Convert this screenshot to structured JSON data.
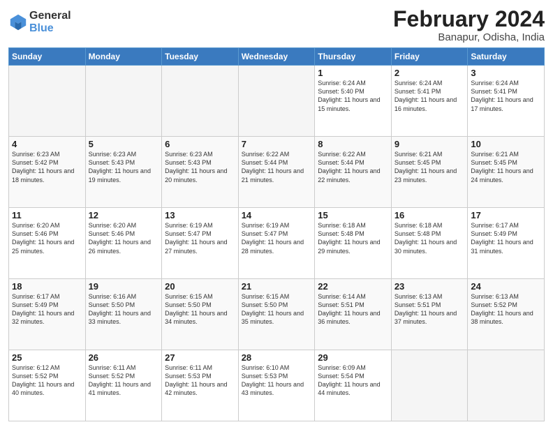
{
  "header": {
    "logo_line1": "General",
    "logo_line2": "Blue",
    "month_title": "February 2024",
    "location": "Banapur, Odisha, India"
  },
  "days_of_week": [
    "Sunday",
    "Monday",
    "Tuesday",
    "Wednesday",
    "Thursday",
    "Friday",
    "Saturday"
  ],
  "weeks": [
    [
      {
        "day": "",
        "info": "",
        "empty": true
      },
      {
        "day": "",
        "info": "",
        "empty": true
      },
      {
        "day": "",
        "info": "",
        "empty": true
      },
      {
        "day": "",
        "info": "",
        "empty": true
      },
      {
        "day": "1",
        "info": "Sunrise: 6:24 AM\nSunset: 5:40 PM\nDaylight: 11 hours\nand 15 minutes.",
        "empty": false
      },
      {
        "day": "2",
        "info": "Sunrise: 6:24 AM\nSunset: 5:41 PM\nDaylight: 11 hours\nand 16 minutes.",
        "empty": false
      },
      {
        "day": "3",
        "info": "Sunrise: 6:24 AM\nSunset: 5:41 PM\nDaylight: 11 hours\nand 17 minutes.",
        "empty": false
      }
    ],
    [
      {
        "day": "4",
        "info": "Sunrise: 6:23 AM\nSunset: 5:42 PM\nDaylight: 11 hours\nand 18 minutes.",
        "empty": false
      },
      {
        "day": "5",
        "info": "Sunrise: 6:23 AM\nSunset: 5:43 PM\nDaylight: 11 hours\nand 19 minutes.",
        "empty": false
      },
      {
        "day": "6",
        "info": "Sunrise: 6:23 AM\nSunset: 5:43 PM\nDaylight: 11 hours\nand 20 minutes.",
        "empty": false
      },
      {
        "day": "7",
        "info": "Sunrise: 6:22 AM\nSunset: 5:44 PM\nDaylight: 11 hours\nand 21 minutes.",
        "empty": false
      },
      {
        "day": "8",
        "info": "Sunrise: 6:22 AM\nSunset: 5:44 PM\nDaylight: 11 hours\nand 22 minutes.",
        "empty": false
      },
      {
        "day": "9",
        "info": "Sunrise: 6:21 AM\nSunset: 5:45 PM\nDaylight: 11 hours\nand 23 minutes.",
        "empty": false
      },
      {
        "day": "10",
        "info": "Sunrise: 6:21 AM\nSunset: 5:45 PM\nDaylight: 11 hours\nand 24 minutes.",
        "empty": false
      }
    ],
    [
      {
        "day": "11",
        "info": "Sunrise: 6:20 AM\nSunset: 5:46 PM\nDaylight: 11 hours\nand 25 minutes.",
        "empty": false
      },
      {
        "day": "12",
        "info": "Sunrise: 6:20 AM\nSunset: 5:46 PM\nDaylight: 11 hours\nand 26 minutes.",
        "empty": false
      },
      {
        "day": "13",
        "info": "Sunrise: 6:19 AM\nSunset: 5:47 PM\nDaylight: 11 hours\nand 27 minutes.",
        "empty": false
      },
      {
        "day": "14",
        "info": "Sunrise: 6:19 AM\nSunset: 5:47 PM\nDaylight: 11 hours\nand 28 minutes.",
        "empty": false
      },
      {
        "day": "15",
        "info": "Sunrise: 6:18 AM\nSunset: 5:48 PM\nDaylight: 11 hours\nand 29 minutes.",
        "empty": false
      },
      {
        "day": "16",
        "info": "Sunrise: 6:18 AM\nSunset: 5:48 PM\nDaylight: 11 hours\nand 30 minutes.",
        "empty": false
      },
      {
        "day": "17",
        "info": "Sunrise: 6:17 AM\nSunset: 5:49 PM\nDaylight: 11 hours\nand 31 minutes.",
        "empty": false
      }
    ],
    [
      {
        "day": "18",
        "info": "Sunrise: 6:17 AM\nSunset: 5:49 PM\nDaylight: 11 hours\nand 32 minutes.",
        "empty": false
      },
      {
        "day": "19",
        "info": "Sunrise: 6:16 AM\nSunset: 5:50 PM\nDaylight: 11 hours\nand 33 minutes.",
        "empty": false
      },
      {
        "day": "20",
        "info": "Sunrise: 6:15 AM\nSunset: 5:50 PM\nDaylight: 11 hours\nand 34 minutes.",
        "empty": false
      },
      {
        "day": "21",
        "info": "Sunrise: 6:15 AM\nSunset: 5:50 PM\nDaylight: 11 hours\nand 35 minutes.",
        "empty": false
      },
      {
        "day": "22",
        "info": "Sunrise: 6:14 AM\nSunset: 5:51 PM\nDaylight: 11 hours\nand 36 minutes.",
        "empty": false
      },
      {
        "day": "23",
        "info": "Sunrise: 6:13 AM\nSunset: 5:51 PM\nDaylight: 11 hours\nand 37 minutes.",
        "empty": false
      },
      {
        "day": "24",
        "info": "Sunrise: 6:13 AM\nSunset: 5:52 PM\nDaylight: 11 hours\nand 38 minutes.",
        "empty": false
      }
    ],
    [
      {
        "day": "25",
        "info": "Sunrise: 6:12 AM\nSunset: 5:52 PM\nDaylight: 11 hours\nand 40 minutes.",
        "empty": false
      },
      {
        "day": "26",
        "info": "Sunrise: 6:11 AM\nSunset: 5:52 PM\nDaylight: 11 hours\nand 41 minutes.",
        "empty": false
      },
      {
        "day": "27",
        "info": "Sunrise: 6:11 AM\nSunset: 5:53 PM\nDaylight: 11 hours\nand 42 minutes.",
        "empty": false
      },
      {
        "day": "28",
        "info": "Sunrise: 6:10 AM\nSunset: 5:53 PM\nDaylight: 11 hours\nand 43 minutes.",
        "empty": false
      },
      {
        "day": "29",
        "info": "Sunrise: 6:09 AM\nSunset: 5:54 PM\nDaylight: 11 hours\nand 44 minutes.",
        "empty": false
      },
      {
        "day": "",
        "info": "",
        "empty": true
      },
      {
        "day": "",
        "info": "",
        "empty": true
      }
    ]
  ]
}
